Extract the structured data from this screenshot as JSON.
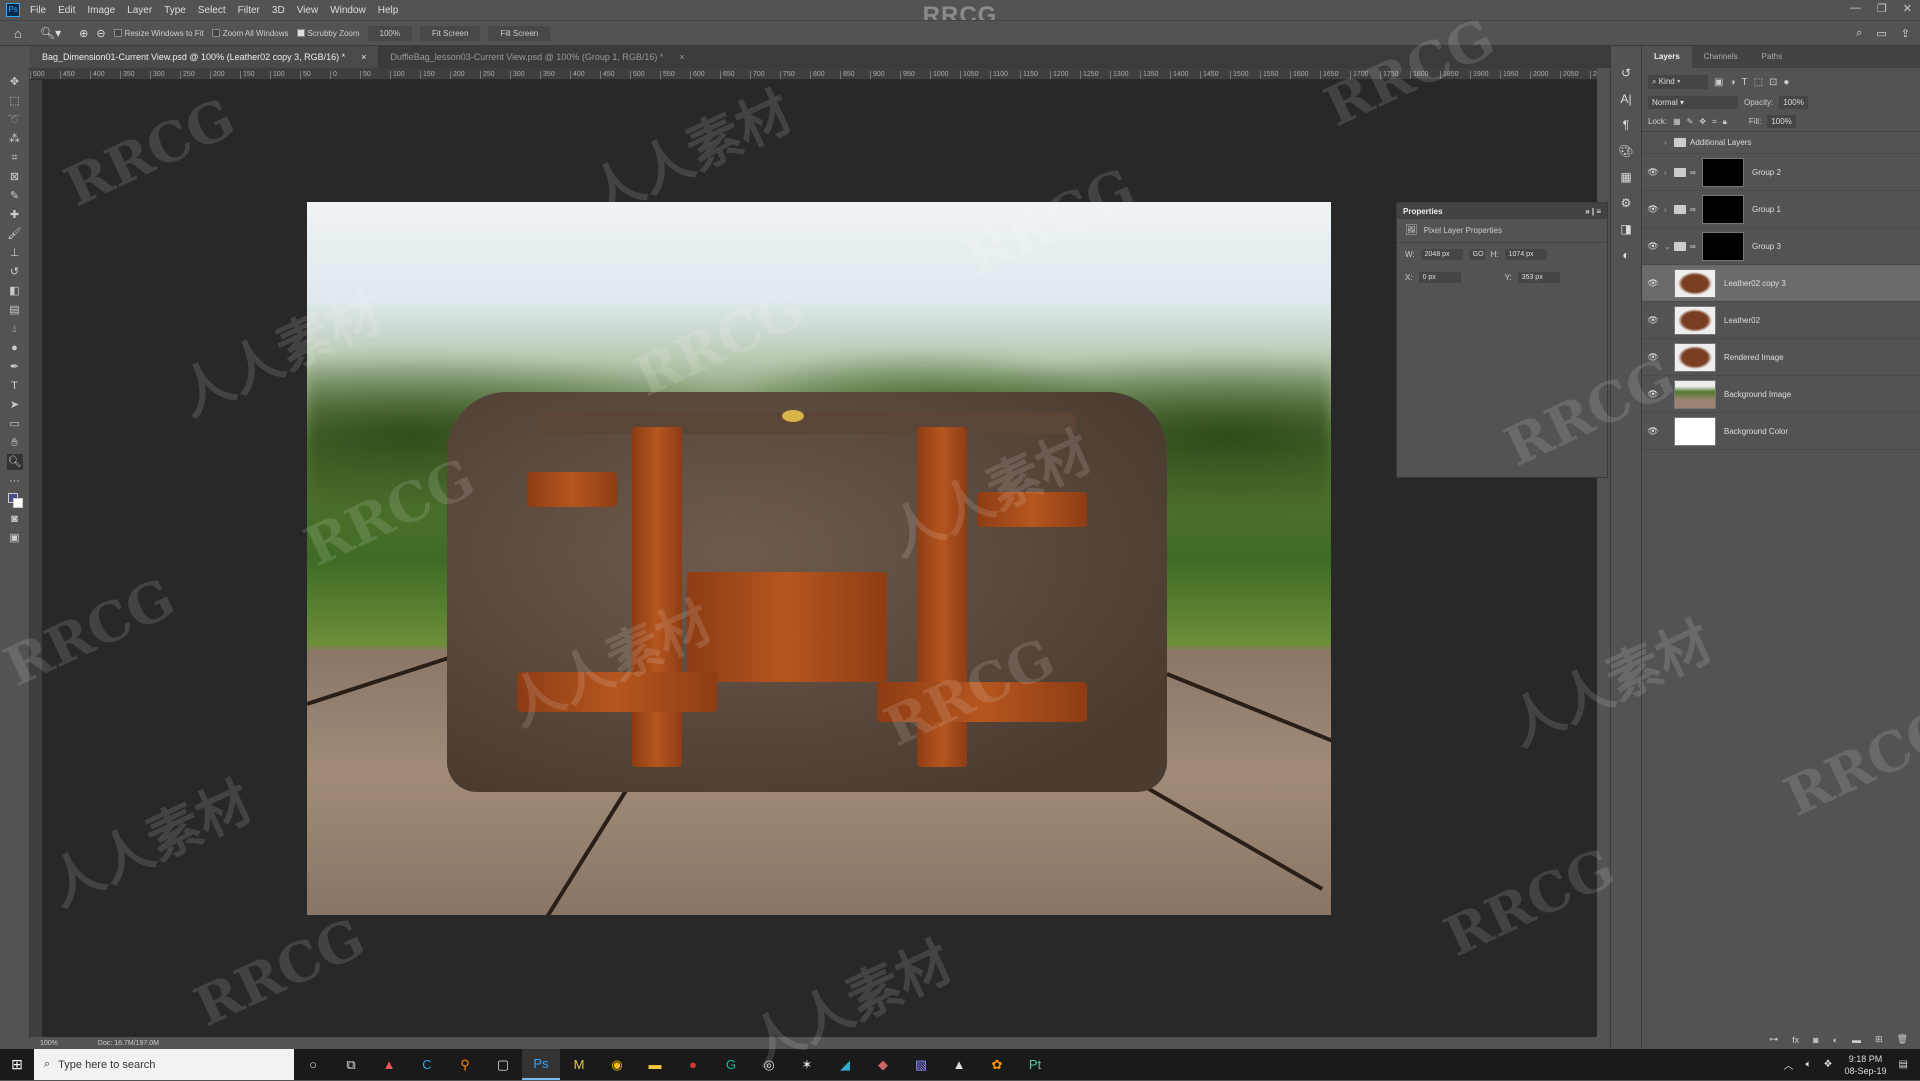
{
  "app": {
    "logo": "Ps",
    "watermark_title": "RRCG",
    "menu": [
      "File",
      "Edit",
      "Image",
      "Layer",
      "Type",
      "Select",
      "Filter",
      "3D",
      "View",
      "Window",
      "Help"
    ]
  },
  "options": {
    "resize_windows": "Resize Windows to Fit",
    "zoom_all": "Zoom All Windows",
    "scrubby_zoom": "Scrubby Zoom",
    "zoom_value": "100%",
    "fit_screen": "Fit Screen",
    "fill_screen": "Fill Screen"
  },
  "tabs": [
    {
      "label": "Bag_Dimension01-Current View.psd @ 100% (Leather02 copy 3, RGB/16) *",
      "active": true
    },
    {
      "label": "DuffleBag_lesson03-Current View.psd @ 100% (Group 1, RGB/16) *",
      "active": false
    }
  ],
  "ruler": [
    "500",
    "450",
    "400",
    "350",
    "300",
    "250",
    "200",
    "150",
    "100",
    "50",
    "0",
    "50",
    "100",
    "150",
    "200",
    "250",
    "300",
    "350",
    "400",
    "450",
    "500",
    "550",
    "600",
    "650",
    "700",
    "750",
    "800",
    "850",
    "900",
    "950",
    "1000",
    "1050",
    "1100",
    "1150",
    "1200",
    "1250",
    "1300",
    "1350",
    "1400",
    "1450",
    "1500",
    "1550",
    "1600",
    "1650",
    "1700",
    "1750",
    "1800",
    "1850",
    "1900",
    "1950",
    "2000",
    "2050",
    "2100",
    "2150",
    "2200",
    "2250",
    "2300",
    "2350",
    "2400",
    "2450",
    "2500",
    "2550"
  ],
  "status": {
    "zoom": "100%",
    "doc": "Doc: 16.7M/197.0M"
  },
  "properties": {
    "title": "Properties",
    "subtitle": "Pixel Layer Properties",
    "w_label": "W:",
    "w": "2048 px",
    "link": "GO",
    "h_label": "H:",
    "h": "1074 px",
    "x_label": "X:",
    "x": "0 px",
    "y_label": "Y:",
    "y": "353 px"
  },
  "layers_panel": {
    "tabs": [
      "Layers",
      "Channels",
      "Paths"
    ],
    "filter": "Kind",
    "blend_mode": "Normal",
    "opacity_label": "Opacity:",
    "opacity": "100%",
    "lock_label": "Lock:",
    "fill_label": "Fill:",
    "fill": "100%",
    "layers": [
      {
        "name": "Additional Layers",
        "type": "group",
        "visible": false,
        "expanded": false
      },
      {
        "name": "Group 2",
        "type": "group",
        "visible": true,
        "expanded": false
      },
      {
        "name": "Group 1",
        "type": "group",
        "visible": true,
        "expanded": false
      },
      {
        "name": "Group 3",
        "type": "group",
        "visible": true,
        "expanded": true
      },
      {
        "name": "Leather02 copy 3",
        "type": "pixel",
        "visible": true,
        "selected": true
      },
      {
        "name": "Leather02",
        "type": "pixel",
        "visible": true
      },
      {
        "name": "Rendered Image",
        "type": "pixel",
        "visible": true
      },
      {
        "name": "Background Image",
        "type": "smart",
        "visible": true
      },
      {
        "name": "Background Color",
        "type": "fill",
        "visible": true
      }
    ]
  },
  "taskbar": {
    "search_placeholder": "Type here to search",
    "time": "9:18 PM",
    "date": "08-Sep-19"
  },
  "watermarks": [
    "RRCG",
    "人人素材"
  ]
}
